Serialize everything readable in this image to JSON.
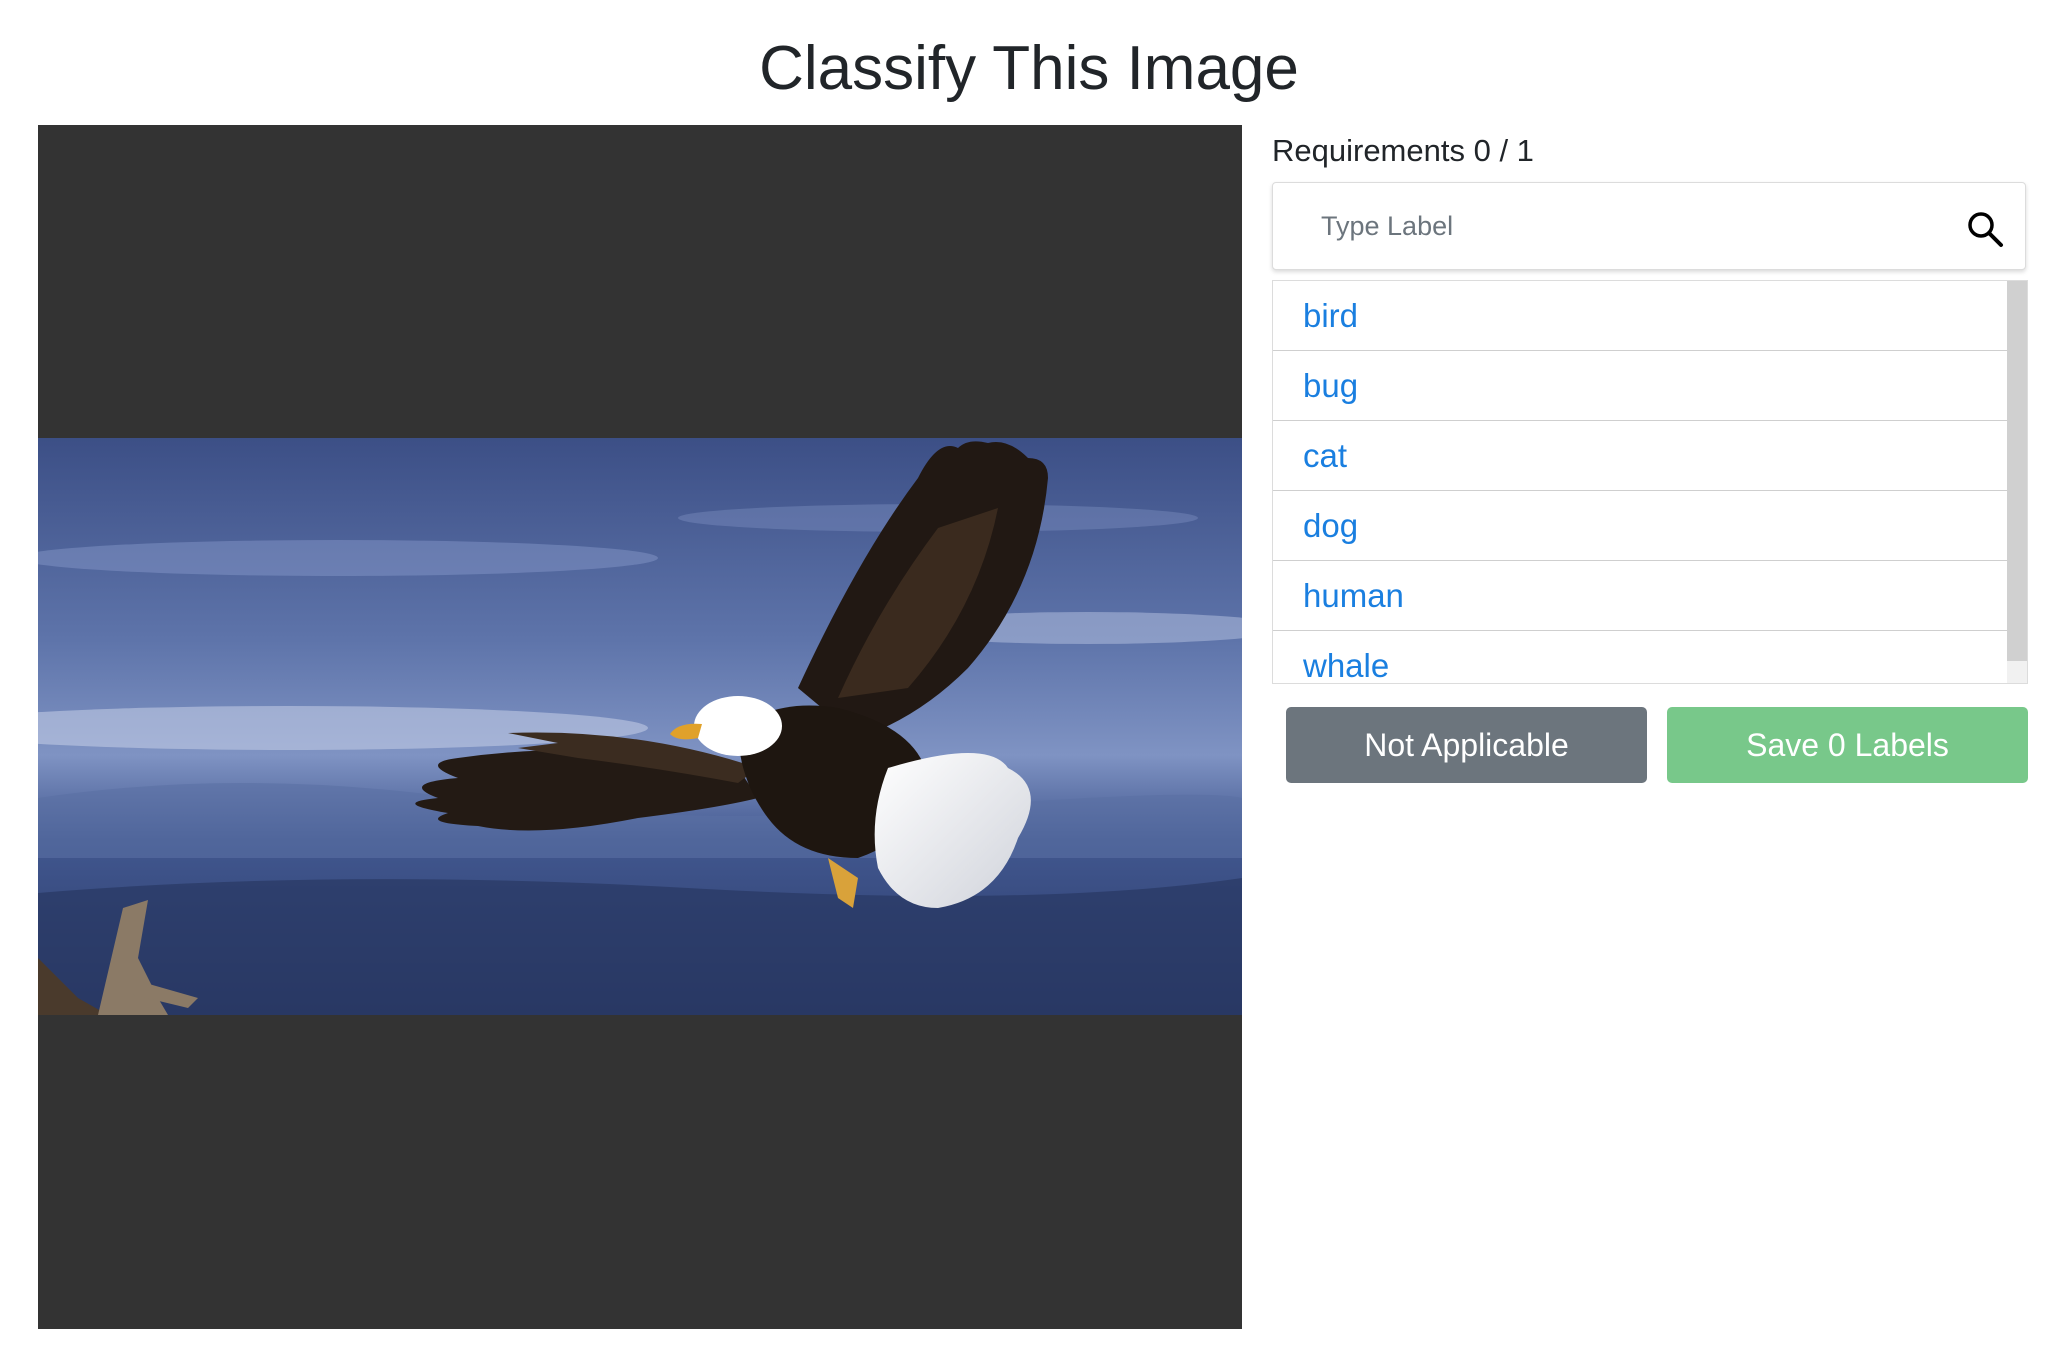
{
  "page": {
    "title": "Classify This Image"
  },
  "image": {
    "subject": "bald eagle in flight",
    "letterbox_color": "#333333"
  },
  "sidebar": {
    "requirements_label": "Requirements 0 / 1",
    "search": {
      "placeholder": "Type Label",
      "value": "",
      "icon": "search-icon"
    },
    "labels": [
      {
        "label": "bird"
      },
      {
        "label": "bug"
      },
      {
        "label": "cat"
      },
      {
        "label": "dog"
      },
      {
        "label": "human"
      },
      {
        "label": "whale"
      }
    ],
    "not_applicable_label": "Not Applicable",
    "save_label": "Save 0 Labels"
  },
  "colors": {
    "link": "#1a7fe0",
    "secondary_button": "#6c757d",
    "save_button": "#78c88a"
  }
}
